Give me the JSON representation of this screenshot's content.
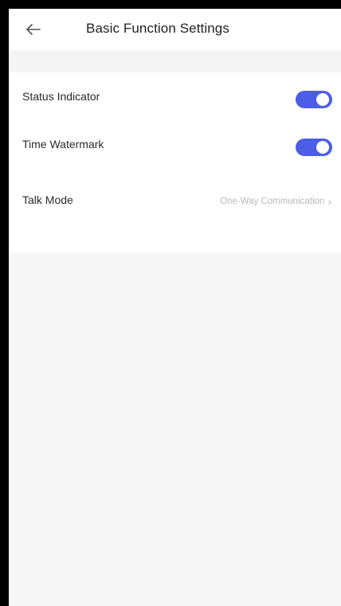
{
  "header": {
    "title": "Basic Function Settings",
    "back_icon": "arrow-left-icon"
  },
  "settings": {
    "status_indicator": {
      "label": "Status Indicator",
      "enabled": true
    },
    "time_watermark": {
      "label": "Time Watermark",
      "enabled": true
    },
    "talk_mode": {
      "label": "Talk Mode",
      "value": "One-Way Communication",
      "chevron": "›"
    }
  },
  "colors": {
    "toggle_on": "#4a5ee6",
    "background": "#f7f7f7",
    "value_text": "#b9b9b9"
  }
}
